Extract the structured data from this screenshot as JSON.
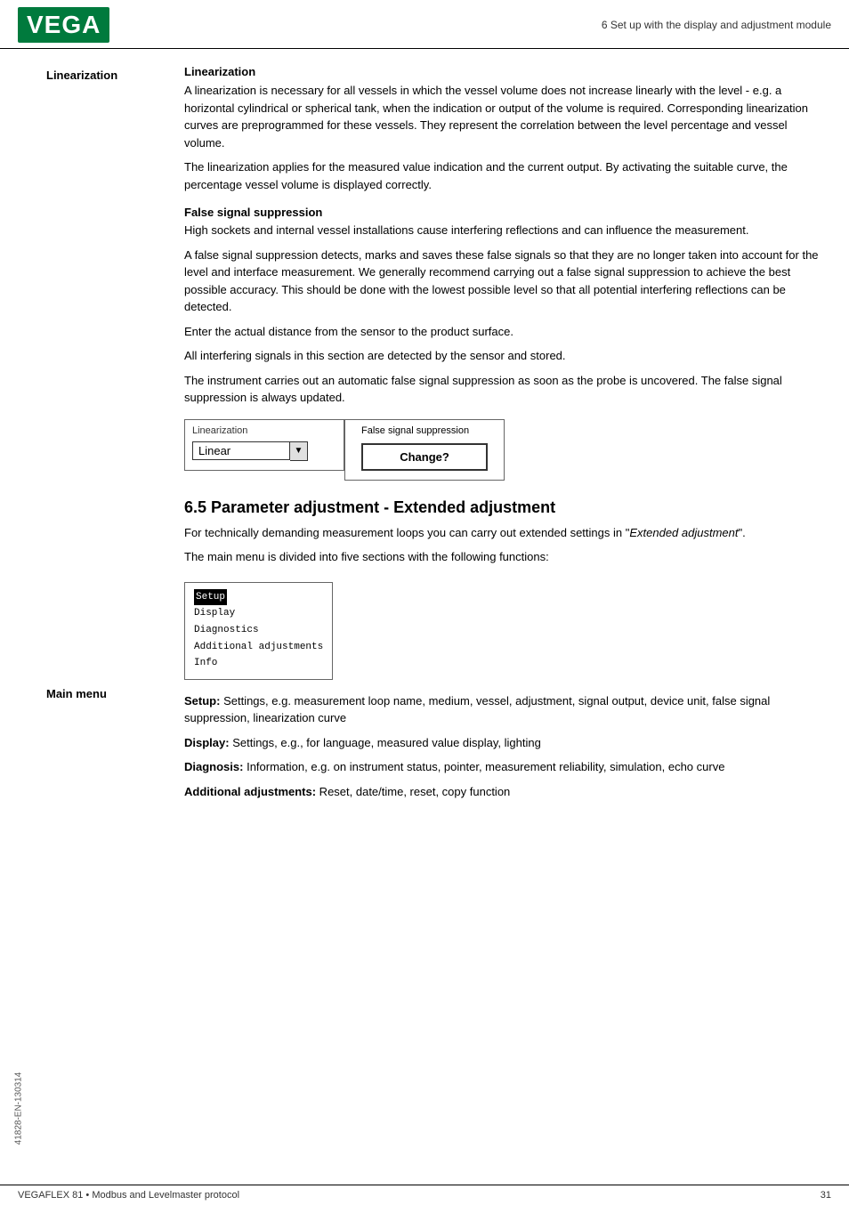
{
  "header": {
    "logo": "VEGA",
    "section_title": "6 Set up with the display and adjustment module"
  },
  "sidebar": {
    "label_linearization": "Linearization",
    "label_main_menu": "Main menu"
  },
  "content": {
    "linearization_heading": "Linearization",
    "linearization_p1": "A linearization is necessary for all vessels in which the vessel volume does not increase linearly with the level - e.g. a horizontal cylindrical or spherical tank, when the indication or output of the volume is required. Corresponding linearization curves are preprogrammed for these vessels. They represent the correlation between the level percentage and vessel volume.",
    "linearization_p2": "The linearization applies for the measured value indication and the current output. By activating the suitable curve, the percentage vessel volume is displayed correctly.",
    "false_signal_heading": "False signal suppression",
    "false_signal_p1": "High sockets and internal vessel installations cause interfering reflections and can influence the measurement.",
    "false_signal_p2": "A false signal suppression detects, marks and saves these false signals so that they are no longer taken into account for the level and interface measurement. We generally recommend carrying out a false signal suppression to achieve the best possible accuracy. This should be done with the lowest possible level so that all potential interfering reflections can be detected.",
    "false_signal_p3": "Enter the actual distance from the sensor to the product surface.",
    "false_signal_p4": "All interfering signals in this section are detected by the sensor and stored.",
    "false_signal_p5": "The instrument carries out an automatic false signal suppression as soon as the probe is uncovered. The false signal suppression is always updated.",
    "widget_linearization_label": "Linearization",
    "widget_linearization_value": "Linear",
    "widget_false_signal_label": "False signal suppression",
    "widget_change_btn": "Change?",
    "section_65_heading": "6.5   Parameter adjustment - Extended adjustment",
    "section_65_p1": "For technically demanding measurement loops you can carry out extended settings in \"",
    "section_65_p1_italic": "Extended adjustment",
    "section_65_p1_end": "\".",
    "main_menu_p1": "The main menu is divided into five sections with the following functions:",
    "menu_items": [
      {
        "label": "Setup",
        "selected": true
      },
      {
        "label": "Display",
        "selected": false
      },
      {
        "label": "Diagnostics",
        "selected": false
      },
      {
        "label": "Additional adjustments",
        "selected": false
      },
      {
        "label": "Info",
        "selected": false
      }
    ],
    "setup_bold": "Setup:",
    "setup_text": " Settings, e.g. measurement loop name, medium, vessel, adjustment, signal output, device unit, false signal suppression, linearization curve",
    "display_bold": "Display:",
    "display_text": " Settings, e.g., for language, measured value display, lighting",
    "diagnosis_bold": "Diagnosis:",
    "diagnosis_text": " Information, e.g. on instrument status, pointer, measurement reliability, simulation, echo curve",
    "additional_bold": "Additional adjustments:",
    "additional_text": " Reset, date/time, reset, copy function"
  },
  "footer": {
    "left": "VEGAFLEX 81 • Modbus and Levelmaster protocol",
    "right": "31"
  },
  "rotated_label": "41828-EN-130314"
}
